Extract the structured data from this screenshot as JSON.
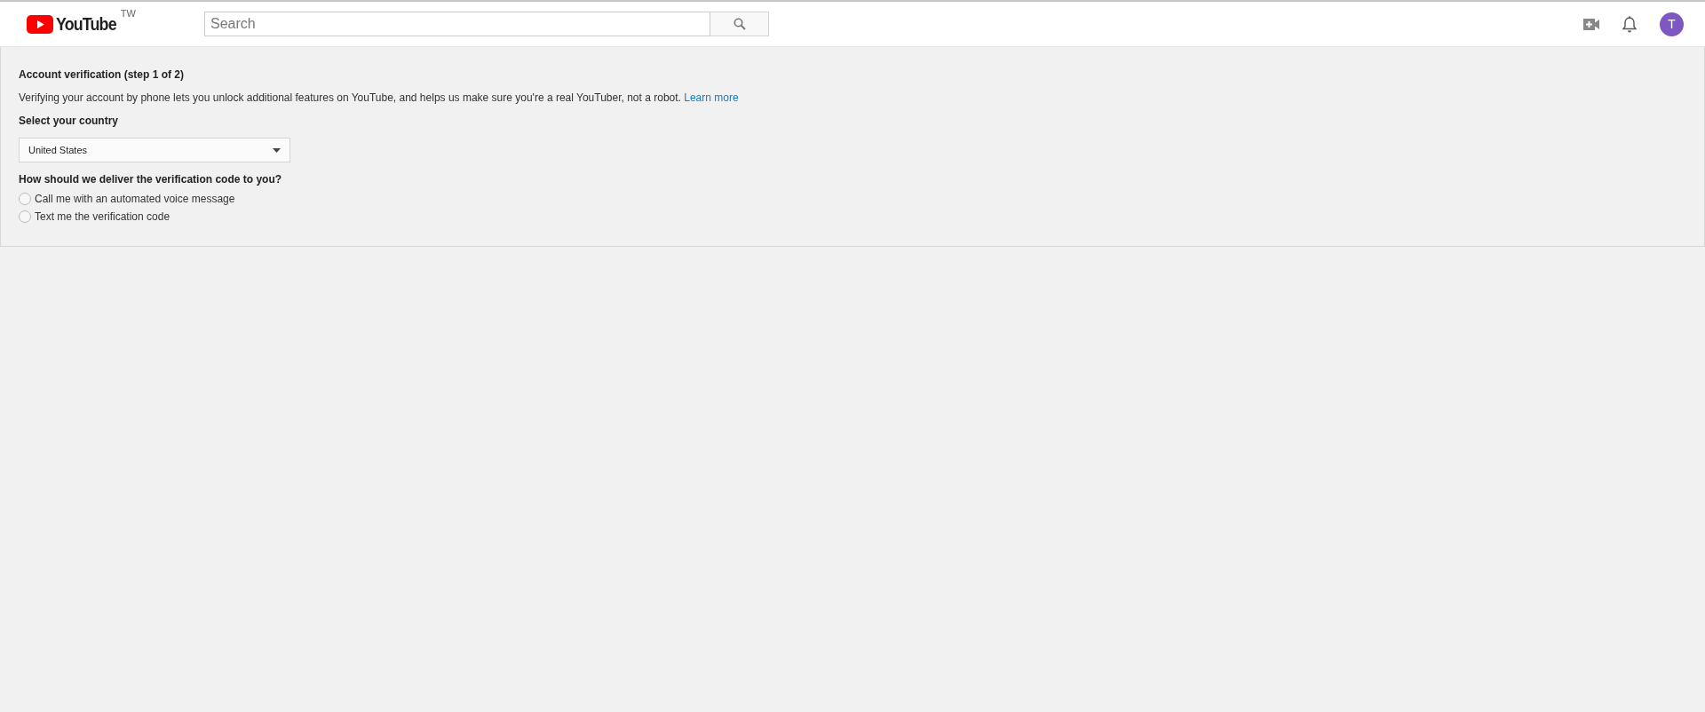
{
  "header": {
    "logo_text": "YouTube",
    "region": "TW",
    "search": {
      "placeholder": "Search"
    },
    "avatar_letter": "T"
  },
  "verification": {
    "title": "Account verification (step 1 of 2)",
    "description": "Verifying your account by phone lets you unlock additional features on YouTube, and helps us make sure you're a real YouTuber, not a robot.",
    "learn_more": "Learn more",
    "country_label": "Select your country",
    "country": "United States",
    "delivery_label": "How should we deliver the verification code to you?",
    "options": [
      {
        "label": "Call me with an automated voice message",
        "selected": false
      },
      {
        "label": "Text me the verification code",
        "selected": false
      }
    ]
  }
}
